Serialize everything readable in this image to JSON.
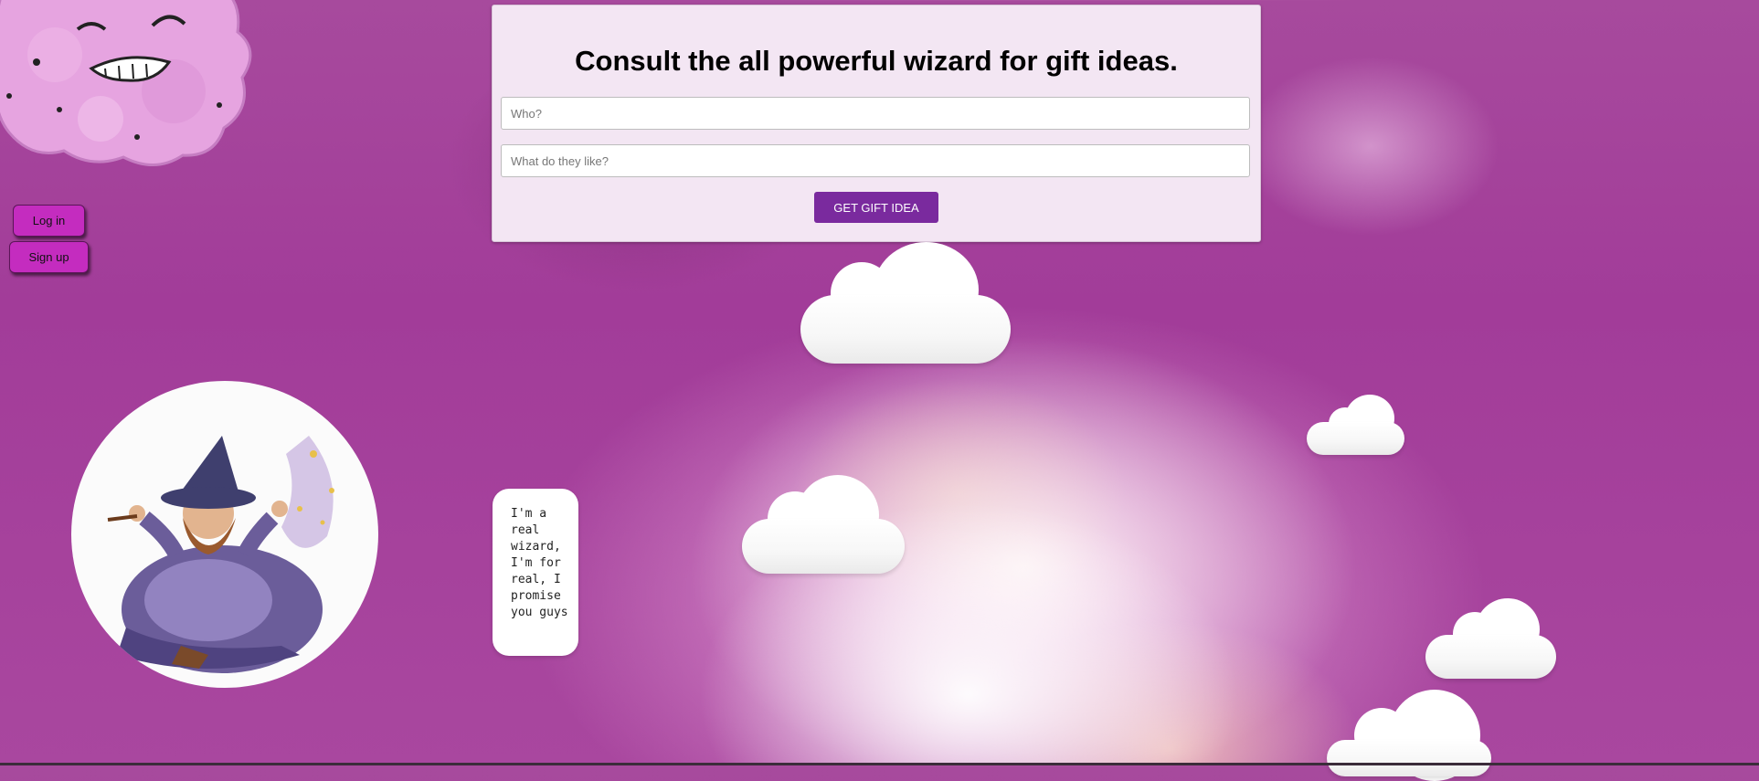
{
  "form": {
    "title": "Consult the all powerful wizard for gift ideas.",
    "who_placeholder": "Who?",
    "likes_placeholder": "What do they like?",
    "submit_label": "GET GIFT IDEA"
  },
  "auth": {
    "login_label": "Log in",
    "signup_label": "Sign up"
  },
  "wizard": {
    "speech": "I'm a real wizard, I'm for real, I promise you guys"
  },
  "colors": {
    "auth_button": "#c42cbf",
    "submit_button": "#7a2a9e",
    "panel_bg": "#f3e6f3",
    "page_bg": "#a23c99"
  }
}
